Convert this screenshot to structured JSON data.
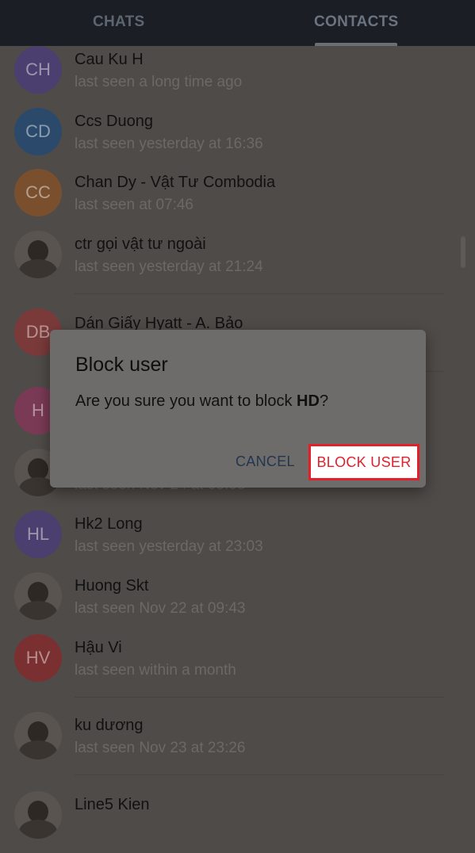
{
  "tabs": [
    {
      "label": "CHATS"
    },
    {
      "label": "CONTACTS"
    }
  ],
  "contacts": [
    {
      "initials": "CH",
      "name": "Cau Ku H",
      "status": "last seen a long time ago",
      "color": "#4a3f6e"
    },
    {
      "initials": "CD",
      "name": "Ccs Duong",
      "status": "last seen yesterday at 16:36",
      "color": "#2b4a6b"
    },
    {
      "initials": "CC",
      "name": "Chan Dy - Vật Tư Combodia",
      "status": "last seen at 07:46",
      "color": "#7a4f2e"
    },
    {
      "initials": "",
      "name": "ctr gọi vật tư ngoài",
      "status": "last seen yesterday at 21:24",
      "color": "#5a5450"
    },
    {
      "initials": "DB",
      "name": "Dán Giấy Hyatt - A. Bảo",
      "status": "",
      "color": "#7a3a3a"
    },
    {
      "initials": "H",
      "name": "",
      "status": "",
      "color": "#7a3a55"
    },
    {
      "initials": "",
      "name": "",
      "status": "last seen Nov 24 at 08:08",
      "color": "#5a5450"
    },
    {
      "initials": "HL",
      "name": "Hk2 Long",
      "status": "last seen yesterday at 23:03",
      "color": "#4a3f6e"
    },
    {
      "initials": "",
      "name": "Huong Skt",
      "status": "last seen Nov 22 at 09:43",
      "color": "#5a5450"
    },
    {
      "initials": "HV",
      "name": "Hậu Vi",
      "status": "last seen within a month",
      "color": "#7a3030"
    },
    {
      "initials": "",
      "name": "ku dương",
      "status": "last seen Nov 23 at 23:26",
      "color": "#5a5450"
    },
    {
      "initials": "",
      "name": "Line5 Kien",
      "status": "",
      "color": "#5a5450"
    }
  ],
  "dialog": {
    "title": "Block user",
    "message_prefix": "Are you sure you want to block ",
    "message_user": "HD",
    "message_suffix": "?",
    "cancel_label": "CANCEL",
    "confirm_label": "BLOCK USER"
  }
}
